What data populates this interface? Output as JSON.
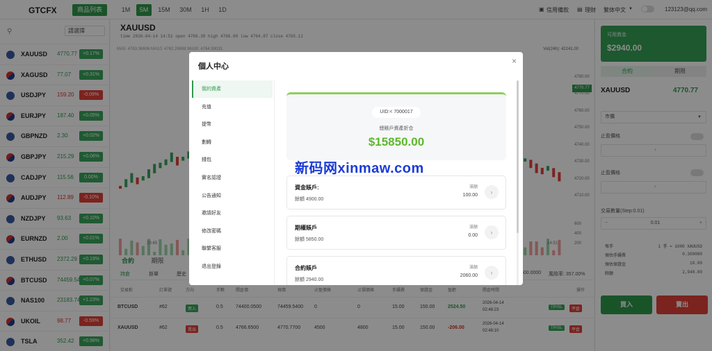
{
  "topbar": {
    "logo": "GTCFX",
    "products_button": "商品列表",
    "timeframes": [
      "1M",
      "5M",
      "15M",
      "30M",
      "1H",
      "1D"
    ],
    "active_timeframe": "5M",
    "credit_record": "信用備款",
    "wealth": "理財",
    "language": "繁体中文",
    "user_email": "123123@qq.com"
  },
  "sidebar": {
    "search_placeholder": "",
    "filter_label": "請選擇",
    "symbols": [
      {
        "name": "XAUUSD",
        "price": "4770.77",
        "change": "+0.17%",
        "dir": "up"
      },
      {
        "name": "XAGUSD",
        "price": "77.07",
        "change": "+0.31%",
        "dir": "up"
      },
      {
        "name": "USDJPY",
        "price": "159.20",
        "change": "-0.09%",
        "dir": "dn"
      },
      {
        "name": "EURJPY",
        "price": "187.40",
        "change": "+0.05%",
        "dir": "up"
      },
      {
        "name": "GBPNZD",
        "price": "2.30",
        "change": "+0.02%",
        "dir": "up"
      },
      {
        "name": "GBPJPY",
        "price": "215.29",
        "change": "+0.06%",
        "dir": "up"
      },
      {
        "name": "CADJPY",
        "price": "115.56",
        "change": "0.00%",
        "dir": "up"
      },
      {
        "name": "AUDJPY",
        "price": "112.89",
        "change": "-0.10%",
        "dir": "dn"
      },
      {
        "name": "NZDJPY",
        "price": "93.63",
        "change": "+0.10%",
        "dir": "up"
      },
      {
        "name": "EURNZD",
        "price": "2.00",
        "change": "+0.01%",
        "dir": "up"
      },
      {
        "name": "ETHUSD",
        "price": "2372.29",
        "change": "+0.19%",
        "dir": "up"
      },
      {
        "name": "BTCUSD",
        "price": "74459.54",
        "change": "+0.07%",
        "dir": "up"
      },
      {
        "name": "NAS100",
        "price": "23183.74",
        "change": "+1.23%",
        "dir": "up"
      },
      {
        "name": "UKOIL",
        "price": "98.77",
        "change": "-0.59%",
        "dir": "dn"
      },
      {
        "name": "TSLA",
        "price": "352.42",
        "change": "+0.98%",
        "dir": "up"
      }
    ]
  },
  "chart": {
    "symbol": "XAUUSD",
    "ohlc": "time 2026-04-14 14:51   open 4769.30   high 4766.80   low 4764.87   close 4765.11",
    "ma_line": "MA5: 4763.36606   MA10: 4762.28698   MA30: 4764.59031",
    "vol_24h": "Vol(24h): 42241.00",
    "price_tag": "4770.77",
    "y_labels": [
      "4780.00",
      "4770.00",
      "4760.00",
      "4750.00",
      "4740.00",
      "4730.00",
      "4720.00",
      "4710.00",
      "600",
      "400",
      "200"
    ],
    "x_labels": [
      "23:45",
      "14:51"
    ]
  },
  "orders": {
    "tabs": [
      "合約",
      "期限"
    ],
    "subtabs": [
      "持倉",
      "掛單",
      "歷史"
    ],
    "headers": [
      "交易對",
      "訂單號",
      "方向",
      "手數",
      "開倉價",
      "現價",
      "止盈價格",
      "止損價格",
      "手續費",
      "保證金",
      "盈虧",
      "開倉時間",
      "操作"
    ],
    "rows": [
      {
        "sym": "BTCUSD",
        "id": "#62",
        "dir": "買入",
        "lots": "0.5",
        "open": "74400.0500",
        "cur": "74459.5400",
        "tp": "0",
        "sl": "0",
        "fee": "15.00",
        "margin": "150.00",
        "pnl": "2524.50",
        "date": "2026-04-14",
        "time": "02:48:23"
      },
      {
        "sym": "XAUUSD",
        "id": "#62",
        "dir": "賣出",
        "lots": "0.5",
        "open": "4766.6500",
        "cur": "4770.7700",
        "tp": "4500",
        "sl": "4800",
        "fee": "15.00",
        "margin": "150.00",
        "pnl": "-206.00",
        "date": "2026-04-14",
        "time": "02:48:10"
      }
    ],
    "action_edit": "TP/SL",
    "action_close": "平倉",
    "extra_val": "500.0000",
    "risk": "風險率: 357.00%"
  },
  "right": {
    "available_label": "可用資金",
    "available_value": "$2940.00",
    "seg_contract": "合約",
    "seg_period": "期限",
    "symbol": "XAUUSD",
    "price": "4770.77",
    "order_type": "市價",
    "tp_label": "止盈價格",
    "sl_label": "止盈價格",
    "qty_label": "交易數量(Step:0.01)",
    "qty_value": "0.01",
    "rows": [
      {
        "k": "每手",
        "v": "1 手 = 1000 XAUUSD"
      },
      {
        "k": "預估手續費",
        "v": "0.300000"
      },
      {
        "k": "預估保證金",
        "v": "10.00"
      },
      {
        "k": "餘額",
        "v": "2,940.00"
      }
    ],
    "buy": "買入",
    "sell": "賣出"
  },
  "modal": {
    "title": "個人中心",
    "nav": [
      "我的資產",
      "充值",
      "提幣",
      "劃轉",
      "錢包",
      "實名認證",
      "公告通知",
      "邀請好友",
      "修改密碼",
      "聯繫客服",
      "退出登錄"
    ],
    "uid": "UID:< 7000017",
    "total_label": "總賬戶資產折合",
    "total_value": "$15850.00",
    "accounts": [
      {
        "title": "資金賬戶:",
        "balance": "餘額 4900.00",
        "bonus_label": "滿額",
        "bonus_value": "100.00"
      },
      {
        "title": "期權賬戶",
        "balance": "餘額 5850.00",
        "bonus_label": "滿額",
        "bonus_value": "0.00"
      },
      {
        "title": "合約賬戶",
        "balance": "餘額 2940.00",
        "bonus_label": "滿額",
        "bonus_value": "2060.00"
      }
    ]
  },
  "watermark": "新码网xinmaw.com",
  "colors": {
    "up": "#2e9a4c",
    "down": "#e0413a",
    "accent": "#5cb82d"
  }
}
